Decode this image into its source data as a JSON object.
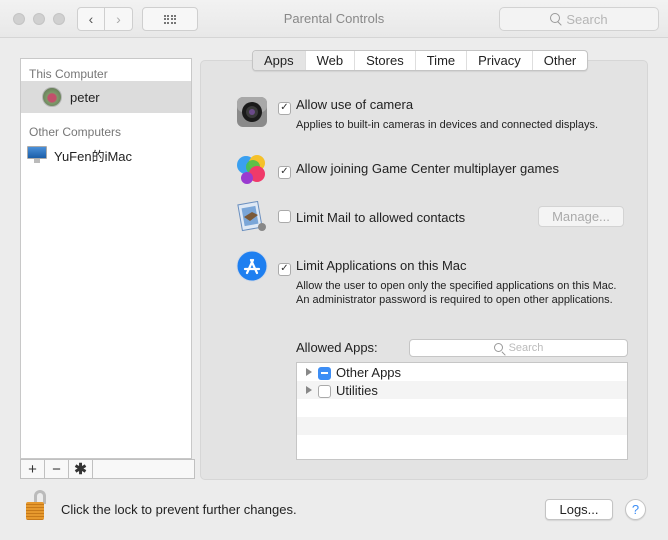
{
  "window": {
    "title": "Parental Controls",
    "search_placeholder": "Search",
    "nav_back": "‹",
    "nav_forward": "›"
  },
  "sidebar": {
    "sections": [
      {
        "header": "This Computer",
        "items": [
          {
            "label": "peter",
            "icon": "user-avatar",
            "selected": true
          }
        ]
      },
      {
        "header": "Other Computers",
        "items": [
          {
            "label": "YuFen的iMac",
            "icon": "imac-icon",
            "selected": false
          }
        ]
      }
    ],
    "toolbar": {
      "add": "+",
      "remove": "−",
      "settings": "✱"
    }
  },
  "tabs": [
    {
      "label": "Apps",
      "active": true
    },
    {
      "label": "Web",
      "active": false
    },
    {
      "label": "Stores",
      "active": false
    },
    {
      "label": "Time",
      "active": false
    },
    {
      "label": "Privacy",
      "active": false
    },
    {
      "label": "Other",
      "active": false
    }
  ],
  "options": {
    "camera": {
      "label": "Allow use of camera",
      "checked": true,
      "desc": "Applies to built-in cameras in devices and connected displays."
    },
    "gamecenter": {
      "label": "Allow joining Game Center multiplayer games",
      "checked": true
    },
    "mail": {
      "label": "Limit Mail to allowed contacts",
      "checked": false,
      "button": "Manage..."
    },
    "apps": {
      "label": "Limit Applications on this Mac",
      "checked": true,
      "desc": "Allow the user to open only the specified applications on this Mac. An administrator password is required to open other applications."
    }
  },
  "allowed_apps": {
    "label": "Allowed Apps:",
    "search_placeholder": "Search",
    "items": [
      {
        "label": "Other Apps",
        "state": "mixed"
      },
      {
        "label": "Utilities",
        "state": "unchecked"
      }
    ]
  },
  "footer": {
    "lock_text": "Click the lock to prevent further changes.",
    "logs_button": "Logs...",
    "help": "?"
  },
  "colors": {
    "accent": "#3d8ef5",
    "panel": "#e3e3e3",
    "selected_row": "#dcdcdc"
  }
}
